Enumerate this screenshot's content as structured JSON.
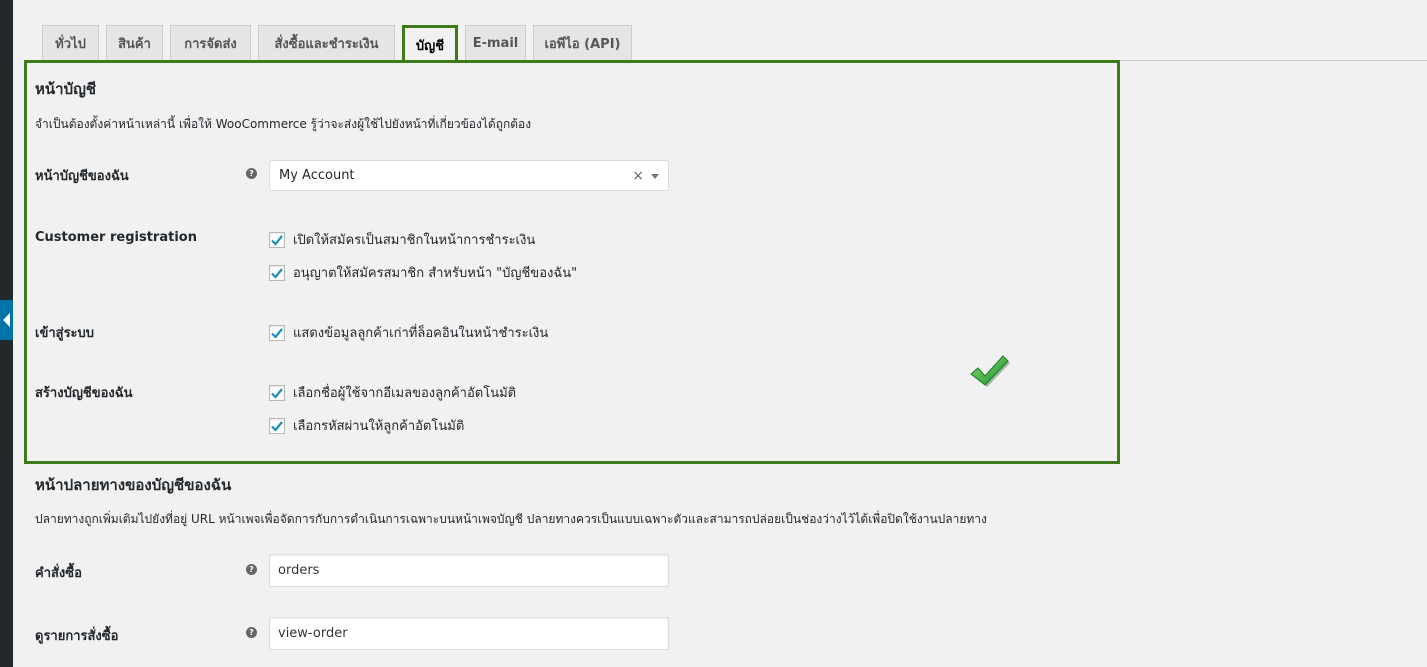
{
  "tabs": [
    {
      "label": "ทั่วไป"
    },
    {
      "label": "สินค้า"
    },
    {
      "label": "การจัดส่ง"
    },
    {
      "label": "สั่งซื้อและชำระเงิน"
    },
    {
      "label": "บัญชี",
      "active": true
    },
    {
      "label": "E-mail"
    },
    {
      "label": "เอพีไอ (API)"
    }
  ],
  "account_pages": {
    "title": "หน้าบัญชี",
    "description": "จำเป็นต้องตั้งค่าหน้าเหล่านี้ เพื่อให้ WooCommerce รู้ว่าจะส่งผู้ใช้ไปยังหน้าที่เกี่ยวข้องได้ถูกต้อง",
    "my_account_label": "หน้าบัญชีของฉัน",
    "my_account_value": "My Account",
    "customer_registration_label": "Customer registration",
    "registration_checkout": "เปิดให้สมัครเป็นสมาชิกในหน้าการชำระเงิน",
    "registration_my_account": "อนุญาตให้สมัครสมาชิก สำหรับหน้า \"บัญชีของฉัน\"",
    "login_label": "เข้าสู่ระบบ",
    "login_reminder": "แสดงข้อมูลลูกค้าเก่าที่ล็อคอินในหน้าชำระเงิน",
    "create_account_label": "สร้างบัญชีของฉัน",
    "generate_username": "เลือกชื่อผู้ใช้จากอีเมลของลูกค้าอัตโนมัติ",
    "generate_password": "เลือกรหัสผ่านให้ลูกค้าอัตโนมัติ"
  },
  "endpoints": {
    "title": "หน้าปลายทางของบัญชีของฉัน",
    "description": "ปลายทางถูกเพิ่มเติมไปยังที่อยู่ URL หน้าเพจเพื่อจัดการกับการดำเนินการเฉพาะบนหน้าเพจบัญชี ปลายทางควรเป็นแบบเฉพาะตัวและสามารถปล่อยเป็นช่องว่างไว้ได้เพื่อปิดใช้งานปลายทาง",
    "orders_label": "คำสั่งซื้อ",
    "orders_value": "orders",
    "view_order_label": "ดูรายการสั่งซื้อ",
    "view_order_value": "view-order"
  },
  "help_glyph": "?",
  "clear_glyph": "×",
  "colors": {
    "highlight": "#3d7a1e",
    "checkbox_tick": "#1e8cbe",
    "admin_dark": "#23282d",
    "admin_accent": "#0073aa",
    "success_check": "#2eaa3a"
  }
}
